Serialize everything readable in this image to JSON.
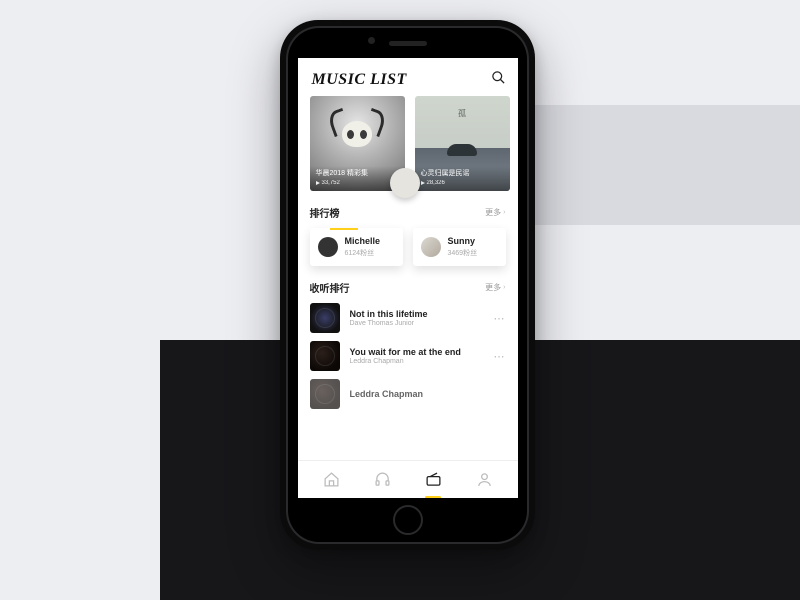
{
  "header": {
    "logo_text": "MUSIC LIST"
  },
  "featured": [
    {
      "title": "华晨2018 精彩集",
      "plays": "33,752"
    },
    {
      "title": "心灵归属是民谣",
      "plays": "28,326"
    }
  ],
  "sections": {
    "rank": {
      "title": "排行榜",
      "more": "更多"
    },
    "listen": {
      "title": "收听排行",
      "more": "更多"
    }
  },
  "artists": [
    {
      "name": "Michelle",
      "fans": "6124粉丝"
    },
    {
      "name": "Sunny",
      "fans": "3469粉丝"
    }
  ],
  "tracks": [
    {
      "title": "Not in this lifetime",
      "artist": "Dave Thomas Junior"
    },
    {
      "title": "You wait for me at the end",
      "artist": "Leddra Chapman"
    },
    {
      "title": "Leddra Chapman",
      "artist": ""
    }
  ],
  "colors": {
    "accent": "#ffcf1a"
  }
}
